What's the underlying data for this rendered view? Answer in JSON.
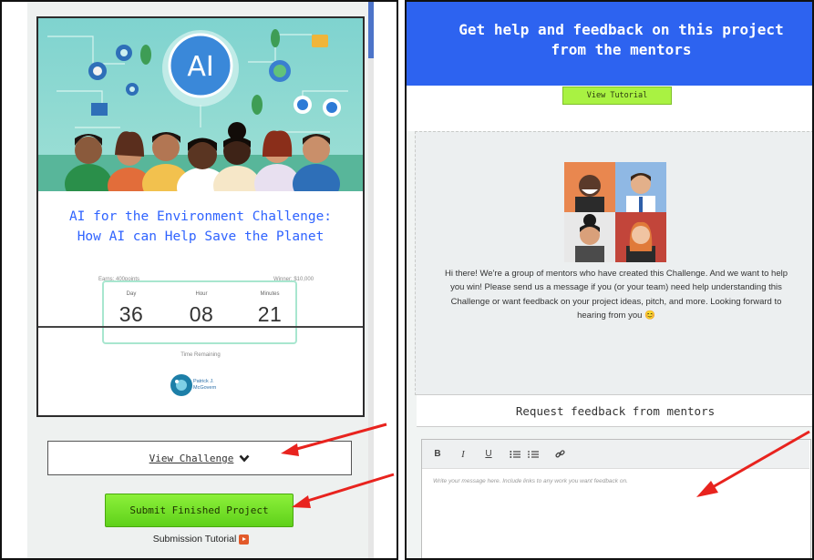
{
  "left": {
    "card": {
      "hero_badge": "AI",
      "title_line1": "AI for the Environment Challenge:",
      "title_line2": "How AI can Help Save the Planet",
      "earns": "Earns: 400points",
      "winner": "Winner: $10,000",
      "countdown": {
        "day_label": "Day",
        "day_value": "36",
        "hour_label": "Hour",
        "hour_value": "08",
        "minutes_label": "Minutes",
        "minutes_value": "21"
      },
      "time_remaining": "Time Remaining",
      "org_logo_line1": "Patrick J.",
      "org_logo_line2": "McGovern"
    },
    "view_challenge_label": "View Challenge",
    "submit_label": "Submit Finished Project",
    "submission_tutorial_label": "Submission Tutorial"
  },
  "right": {
    "header_line1": "Get help and feedback on this project",
    "header_line2": "from the mentors",
    "view_tutorial_label": "View Tutorial",
    "mentor_message": "Hi there! We're a group of mentors who have created this Challenge. And we want to help you win! Please send us a message if you (or your team) need help understanding this Challenge or want feedback on your project ideas, pitch, and more. Looking forward to hearing from you 😊",
    "request_feedback_label": "Request feedback from mentors",
    "editor": {
      "bold": "B",
      "italic": "I",
      "underline": "U",
      "placeholder": "Write your message here. Include links to any work you want feedback on."
    }
  },
  "colors": {
    "header_blue": "#2d63f0",
    "title_blue": "#2f63ff",
    "submit_green": "#6ee02a",
    "tutorial_green": "#a9f242",
    "annotation_red": "#e8231e"
  }
}
